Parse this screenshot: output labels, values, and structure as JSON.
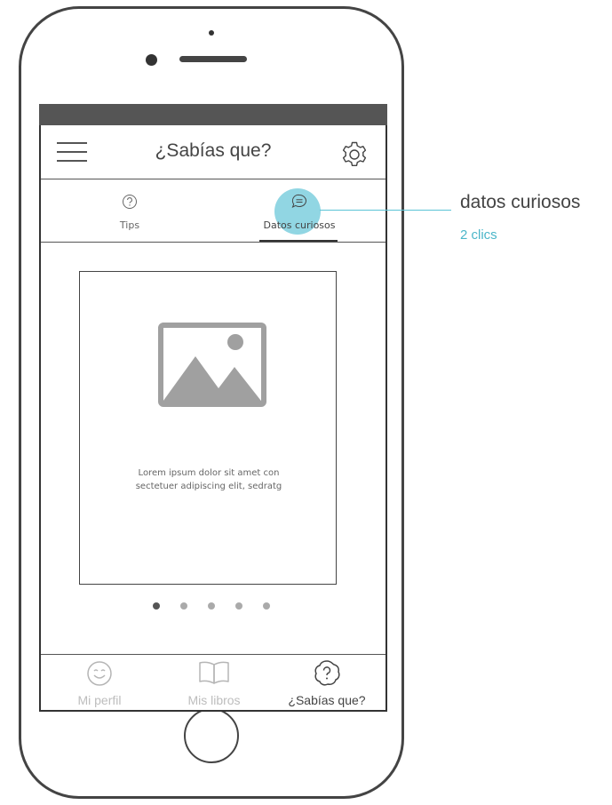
{
  "header": {
    "title": "¿Sabías que?"
  },
  "tabs": [
    {
      "label": "Tips",
      "icon": "question-circle-icon",
      "active": false
    },
    {
      "label": "Datos curiosos",
      "icon": "chat-bubble-icon",
      "active": true
    }
  ],
  "card": {
    "text_line1": "Lorem ipsum dolor sit amet con",
    "text_line2": "sectetuer adipiscing elit, sedratg",
    "image_icon": "image-placeholder-icon"
  },
  "pagination": {
    "total": 5,
    "active_index": 0
  },
  "bottom_nav": [
    {
      "label": "Mi perfil",
      "icon": "smiley-icon",
      "active": false
    },
    {
      "label": "Mis libros",
      "icon": "open-book-icon",
      "active": false
    },
    {
      "label": "¿Sabías que?",
      "icon": "question-bubble-icon",
      "active": true
    }
  ],
  "annotation": {
    "title": "datos curiosos",
    "subtitle": "2 clics"
  },
  "colors": {
    "accent": "#7ecfde",
    "annotation_accent": "#4bb6c9",
    "status_bar": "#555555",
    "inactive_nav": "#bdbdbd",
    "active_nav": "#444444"
  }
}
